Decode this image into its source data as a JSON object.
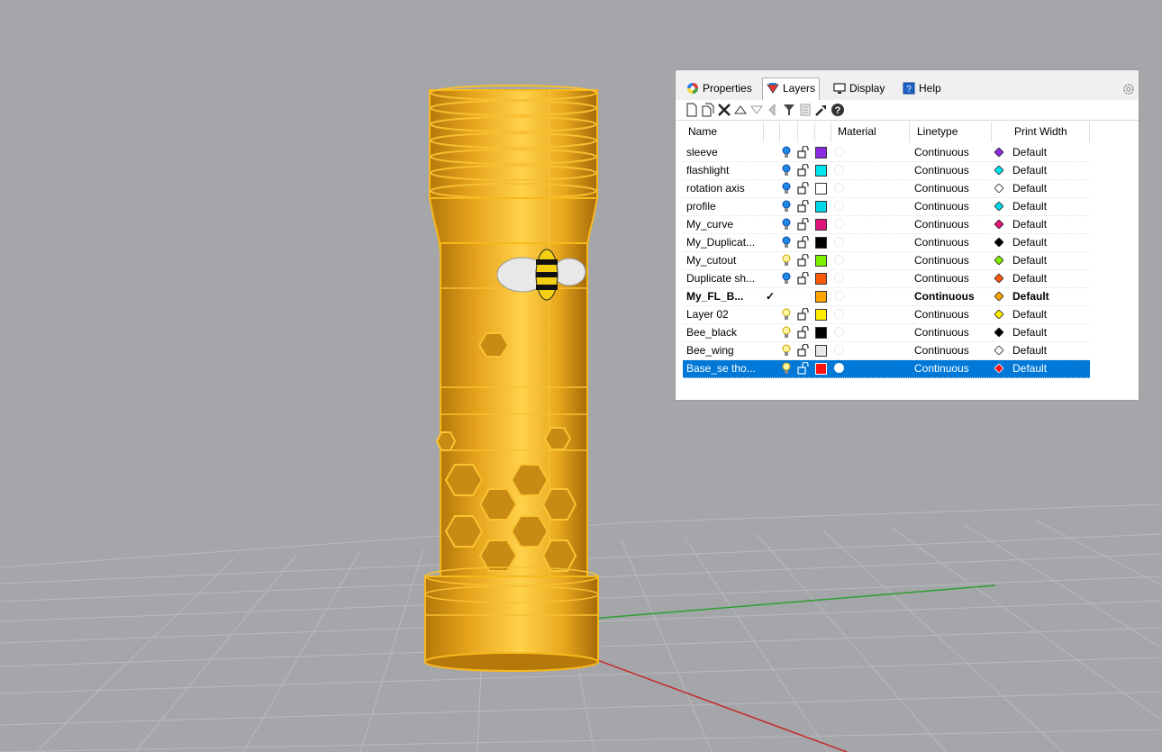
{
  "viewport": {
    "background": "#a4a6a9",
    "object_color": "#f0b21f",
    "x_axis_color": "#c62828",
    "y_axis_color": "#2e9e34"
  },
  "panel": {
    "tabs": [
      {
        "label": "Properties",
        "icon": "color-wheel-icon",
        "active": false
      },
      {
        "label": "Layers",
        "icon": "layers-icon",
        "active": true
      },
      {
        "label": "Display",
        "icon": "monitor-icon",
        "active": false
      },
      {
        "label": "Help",
        "icon": "help-book-icon",
        "active": false
      }
    ],
    "toolbar": [
      "new-layer-icon",
      "new-sublayer-icon",
      "delete-icon",
      "move-up-icon",
      "move-down-icon",
      "move-out-icon",
      "filter-icon",
      "layer-states-icon",
      "tools-icon",
      "help-icon"
    ],
    "columns": {
      "name": "Name",
      "material": "Material",
      "linetype": "Linetype",
      "print_width": "Print Width"
    },
    "rows": [
      {
        "name": "sleeve",
        "color": "#8a2be2",
        "linetype": "Continuous",
        "print_color": "#8a2be2",
        "print_width": "Default",
        "bulb": "on"
      },
      {
        "name": "flashlight",
        "color": "#00e5ee",
        "linetype": "Continuous",
        "print_color": "#00e5ee",
        "print_width": "Default",
        "bulb": "on"
      },
      {
        "name": "rotation axis",
        "color": "#ffffff",
        "linetype": "Continuous",
        "print_color": "#ffffff",
        "print_width": "Default",
        "bulb": "on"
      },
      {
        "name": "profile",
        "color": "#00d7e8",
        "linetype": "Continuous",
        "print_color": "#00d7e8",
        "print_width": "Default",
        "bulb": "on"
      },
      {
        "name": "My_curve",
        "color": "#e0157a",
        "linetype": "Continuous",
        "print_color": "#e0157a",
        "print_width": "Default",
        "bulb": "on"
      },
      {
        "name": "My_Duplicat...",
        "color": "#000000",
        "linetype": "Continuous",
        "print_color": "#000000",
        "print_width": "Default",
        "bulb": "on"
      },
      {
        "name": "My_cutout",
        "color": "#7ff000",
        "linetype": "Continuous",
        "print_color": "#7ff000",
        "print_width": "Default",
        "bulb": "off"
      },
      {
        "name": "Duplicate sh...",
        "color": "#ff5a0a",
        "linetype": "Continuous",
        "print_color": "#ff5a0a",
        "print_width": "Default",
        "bulb": "on"
      },
      {
        "name": "My_FL_B...",
        "color": "#ffa500",
        "linetype": "Continuous",
        "print_color": "#ffa500",
        "print_width": "Default",
        "bulb": "none",
        "current": true,
        "check": "✓"
      },
      {
        "name": "Layer 02",
        "color": "#ffee00",
        "linetype": "Continuous",
        "print_color": "#ffee00",
        "print_width": "Default",
        "bulb": "off"
      },
      {
        "name": "Bee_black",
        "color": "#000000",
        "linetype": "Continuous",
        "print_color": "#000000",
        "print_width": "Default",
        "bulb": "off"
      },
      {
        "name": "Bee_wing",
        "color": "#e8e8e8",
        "linetype": "Continuous",
        "print_color": "#ffffff",
        "print_width": "Default",
        "bulb": "off"
      },
      {
        "name": "Base_se tho...",
        "color": "#ff1010",
        "linetype": "Continuous",
        "print_color": "#ff1010",
        "print_width": "Default",
        "bulb": "off",
        "selected": true
      }
    ]
  }
}
